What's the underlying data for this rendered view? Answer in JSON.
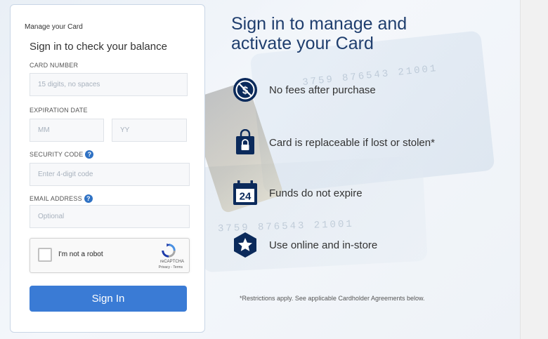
{
  "panel": {
    "manage_label": "Manage your Card",
    "subtitle": "Sign in to check your balance",
    "card_number": {
      "label": "CARD NUMBER",
      "placeholder": "15 digits, no spaces"
    },
    "expiration": {
      "label": "EXPIRATION DATE",
      "month_placeholder": "MM",
      "year_placeholder": "YY"
    },
    "security": {
      "label": "SECURITY CODE",
      "placeholder": "Enter 4-digit code",
      "help": "?"
    },
    "email": {
      "label": "EMAIL ADDRESS",
      "placeholder": "Optional",
      "help": "?"
    },
    "captcha": {
      "label": "I'm not a robot",
      "brand": "reCAPTCHA",
      "terms": "Privacy - Terms"
    },
    "sign_in_label": "Sign In"
  },
  "promo": {
    "headline_line1": "Sign in to manage and",
    "headline_line2": "activate your Card",
    "features": [
      {
        "icon": "no-dollar-icon",
        "text": "No fees after purchase"
      },
      {
        "icon": "lock-bag-icon",
        "text": "Card is replaceable if lost or stolen*"
      },
      {
        "icon": "calendar-24-icon",
        "text": "Funds do not expire",
        "icon_text": "24"
      },
      {
        "icon": "star-hexagon-icon",
        "text": "Use online and in-store"
      }
    ],
    "disclaimer": "*Restrictions apply. See applicable Cardholder Agreements below."
  },
  "background": {
    "card_number_1": "3759 876543 21001",
    "card_number_2": "3759 876543 21001"
  },
  "colors": {
    "accent": "#3a7bd5",
    "heading": "#1f3e6e",
    "icon": "#0b2a5b",
    "help": "#2f72c4"
  }
}
